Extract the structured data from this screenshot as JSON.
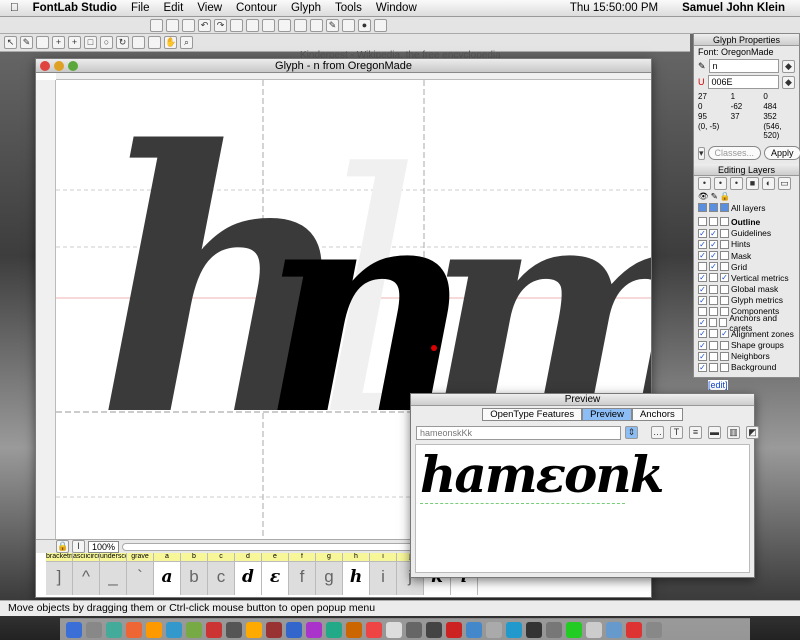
{
  "menubar": {
    "app": "FontLab Studio",
    "items": [
      "File",
      "Edit",
      "View",
      "Contour",
      "Glyph",
      "Tools",
      "Window"
    ],
    "clock": "Thu 15:50:00 PM",
    "user": "Samuel John Klein"
  },
  "background_window": {
    "title": "Kinderpest - Wikipedia, the free encyclopedia"
  },
  "glyph_window": {
    "title": "Glyph - n from OregonMade",
    "zoom": "100%",
    "glyphs_shown": {
      "left": "h",
      "current": "n",
      "right": "m"
    }
  },
  "glyph_strip": [
    {
      "name": "bracketright",
      "glyph": "]",
      "defined": false
    },
    {
      "name": "asciicircum",
      "glyph": "^",
      "defined": false
    },
    {
      "name": "underscore",
      "glyph": "_",
      "defined": false
    },
    {
      "name": "grave",
      "glyph": "`",
      "defined": false
    },
    {
      "name": "a",
      "glyph": "a",
      "defined": true
    },
    {
      "name": "b",
      "glyph": "b",
      "defined": false
    },
    {
      "name": "c",
      "glyph": "c",
      "defined": false
    },
    {
      "name": "d",
      "glyph": "d",
      "defined": true
    },
    {
      "name": "e",
      "glyph": "ε",
      "defined": true
    },
    {
      "name": "f",
      "glyph": "f",
      "defined": false
    },
    {
      "name": "g",
      "glyph": "g",
      "defined": false
    },
    {
      "name": "h",
      "glyph": "h",
      "defined": true
    },
    {
      "name": "i",
      "glyph": "i",
      "defined": false
    },
    {
      "name": "j",
      "glyph": "j",
      "defined": false
    },
    {
      "name": "k",
      "glyph": "k",
      "defined": true
    },
    {
      "name": "l",
      "glyph": "l",
      "defined": true
    }
  ],
  "status": "Move objects by dragging them or Ctrl-click mouse button to open popup menu",
  "glyph_properties": {
    "title": "Glyph Properties",
    "font": "Font: OregonMade",
    "name": "n",
    "unicode": "006E",
    "metrics": [
      "27",
      "1",
      "0",
      "0",
      "-62",
      "484",
      "95",
      "37",
      "352",
      "(0, -5)",
      "",
      "(546, 520)"
    ],
    "classes": "Classes...",
    "apply": "Apply"
  },
  "editing_layers": {
    "title": "Editing Layers",
    "all": "All layers",
    "edit_link": "[edit]",
    "layers": [
      {
        "label": "Outline",
        "c": [
          false,
          false,
          false
        ],
        "bold": true
      },
      {
        "label": "Guidelines",
        "c": [
          true,
          true,
          false
        ]
      },
      {
        "label": "Hints",
        "c": [
          true,
          true,
          false
        ]
      },
      {
        "label": "Mask",
        "c": [
          true,
          true,
          false
        ]
      },
      {
        "label": "Grid",
        "c": [
          false,
          true,
          false
        ]
      },
      {
        "label": "Vertical metrics",
        "c": [
          true,
          false,
          true
        ]
      },
      {
        "label": "Global mask",
        "c": [
          true,
          false,
          false
        ]
      },
      {
        "label": "Glyph metrics",
        "c": [
          true,
          false,
          false
        ]
      },
      {
        "label": "Components",
        "c": [
          false,
          false,
          false
        ]
      },
      {
        "label": "Anchors and carets",
        "c": [
          true,
          false,
          false
        ]
      },
      {
        "label": "Alignment zones",
        "c": [
          true,
          false,
          true
        ]
      },
      {
        "label": "Shape groups",
        "c": [
          true,
          false,
          false
        ]
      },
      {
        "label": "Neighbors",
        "c": [
          true,
          false,
          false
        ]
      },
      {
        "label": "Background",
        "c": [
          true,
          false,
          false
        ]
      }
    ]
  },
  "preview": {
    "title": "Preview",
    "tabs": [
      "OpenType Features",
      "Preview",
      "Anchors"
    ],
    "active_tab": "Preview",
    "text_input": "hameonskKk",
    "rendered": "hamεonk"
  }
}
